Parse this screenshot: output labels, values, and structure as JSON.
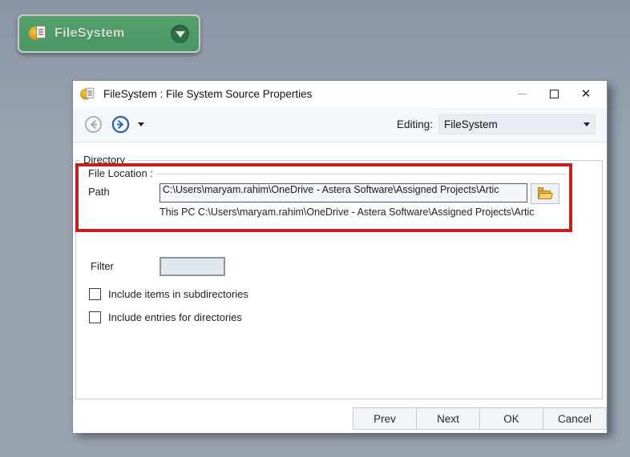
{
  "canvas": {
    "background_color": "#99a3b0"
  },
  "node": {
    "label": "FileSystem",
    "color": "#4f9c68",
    "icon": "filesystem-doc-icon",
    "dropdown_icon": "chevron-down-icon"
  },
  "dialog": {
    "title": "FileSystem : File System Source Properties",
    "titlebar_icon": "filesystem-doc-icon",
    "window_controls": {
      "minimize": "minimize",
      "maximize": "maximize",
      "close": "close"
    },
    "toolbar": {
      "back_icon": "back-arrow-icon",
      "forward_icon": "forward-arrow-icon",
      "forward_dropdown_icon": "chevron-down-icon",
      "editing_label": "Editing:",
      "editing_value": "FileSystem"
    },
    "directory_group": {
      "label": "Directory",
      "file_location": {
        "label": "File Location :",
        "path_label": "Path",
        "path_value": "C:\\Users\\maryam.rahim\\OneDrive - Astera Software\\Assigned Projects\\Artic",
        "browse_icon": "folder-icon",
        "resolved_path": "This PC C:\\Users\\maryam.rahim\\OneDrive - Astera Software\\Assigned Projects\\Artic"
      },
      "filter_label": "Filter",
      "filter_value": "",
      "checkboxes": [
        {
          "label": "Include items in subdirectories",
          "checked": false
        },
        {
          "label": "Include entries for directories",
          "checked": false
        }
      ],
      "highlight_color": "#c41e1e"
    },
    "footer": {
      "buttons": [
        "Prev",
        "Next",
        "OK",
        "Cancel"
      ]
    }
  }
}
